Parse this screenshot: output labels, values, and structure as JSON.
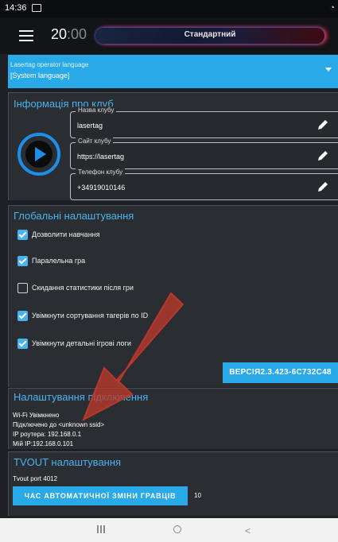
{
  "status_bar": {
    "time": "14:36"
  },
  "app_bar": {
    "clock_hours": "20",
    "clock_minutes": ":00",
    "mode_label": "Стандартний"
  },
  "language": {
    "label": "Lasertag operator language",
    "value": "[System language]"
  },
  "club_info": {
    "title": "Інформація про клуб",
    "fields": [
      {
        "label": "Назва клубу",
        "value": "lasertag"
      },
      {
        "label": "Сайт клубу",
        "value": "https://lasertag"
      },
      {
        "label": "Телефон клубу",
        "value": "+34919010146"
      }
    ]
  },
  "global_settings": {
    "title": "Глобальні налаштування",
    "options": [
      {
        "label": "Дозволити навчання",
        "checked": true
      },
      {
        "label": "Паралельна гра",
        "checked": true
      },
      {
        "label": "Скидання статистики після гри",
        "checked": false
      },
      {
        "label": "Увімкнути сортування тагерів по ID",
        "checked": true
      },
      {
        "label": "Увімкнути детальні ігрові логи",
        "checked": true
      }
    ],
    "version_label": "ВЕРСІЯ2.3.423-6C732C48"
  },
  "connection_settings": {
    "title": "Налаштування підключення",
    "lines": [
      "Wi-Fi Увімкнено",
      "Підключено до <unknown ssid>",
      "IP роутера: 192.168.0.1",
      "Мій IP:192.168.0.101"
    ]
  },
  "tvout_settings": {
    "title": "TVOUT налаштування",
    "port_text": "Tvout port 4012",
    "auto_switch_label": "ЧАС АВТОМАТИЧНОЇ ЗМІНИ ГРАВЦІВ",
    "auto_switch_value": "10"
  },
  "colors": {
    "accent": "#29a9e8",
    "title_blue": "#4ab3ef",
    "card_bg": "#2a2d31",
    "arrow_red": "#c0392b"
  },
  "icons": [
    "menu-icon",
    "play-icon",
    "pencil-icon",
    "checkbox-icon",
    "wifi-icon",
    "nav-recent-icon",
    "nav-home-icon",
    "nav-back-icon",
    "arrow-overlay"
  ]
}
